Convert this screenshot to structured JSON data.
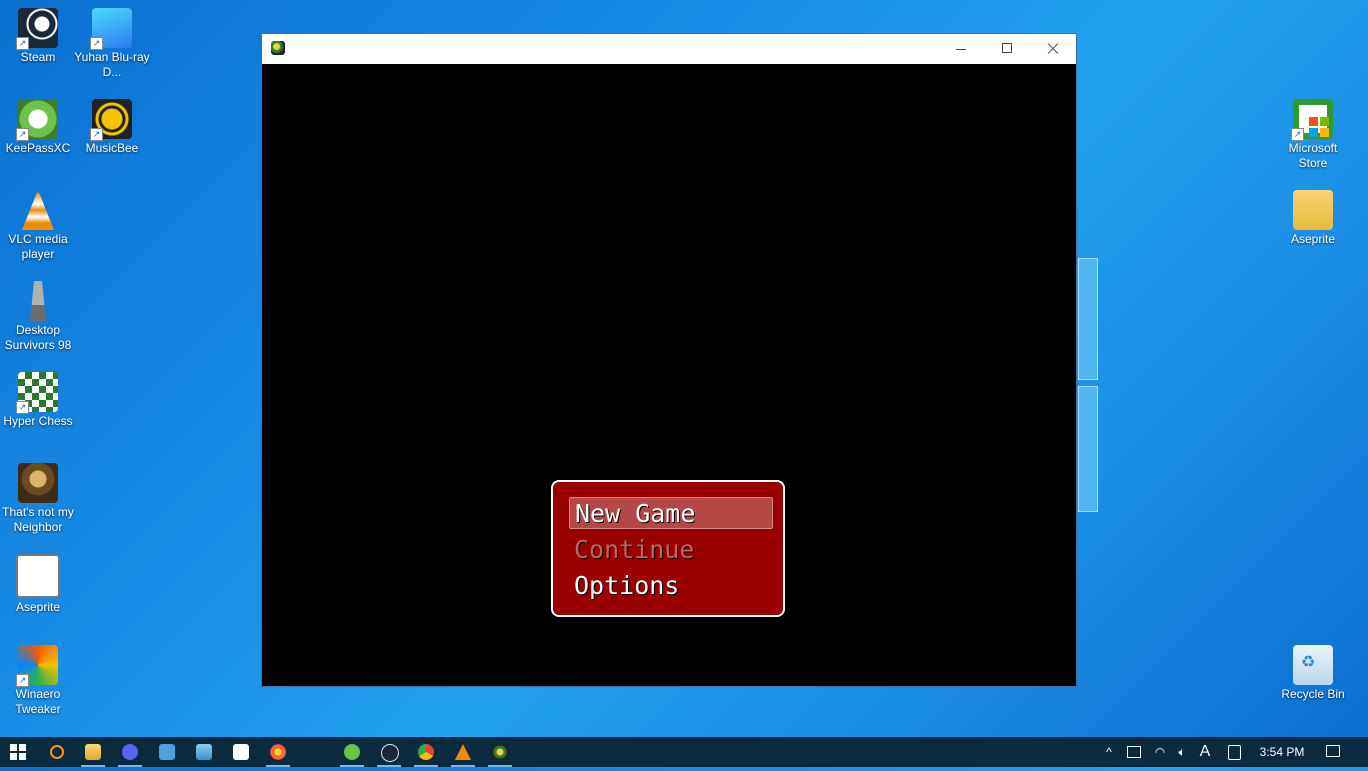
{
  "desktop": {
    "icons_left": [
      {
        "label": "Steam",
        "icon": "steam-icon"
      },
      {
        "label": "Yuhan Blu-ray D...",
        "icon": "yuhan-bluray-icon"
      },
      {
        "label": "KeePassXC",
        "icon": "keepassxc-icon"
      },
      {
        "label": "MusicBee",
        "icon": "musicbee-icon"
      },
      {
        "label": "VLC media player",
        "icon": "vlc-icon"
      },
      {
        "label": "Desktop Survivors 98",
        "icon": "desktop-survivors-icon"
      },
      {
        "label": "Hyper Chess",
        "icon": "hyper-chess-icon"
      },
      {
        "label": "That's not my Neighbor",
        "icon": "thats-not-my-neighbor-icon"
      },
      {
        "label": "Aseprite",
        "icon": "aseprite-icon"
      },
      {
        "label": "Winaero Tweaker",
        "icon": "winaero-tweaker-icon"
      }
    ],
    "icons_right": [
      {
        "label": "Microsoft Store",
        "icon": "microsoft-store-icon"
      },
      {
        "label": "Aseprite",
        "icon": "folder-icon"
      },
      {
        "label": "Recycle Bin",
        "icon": "recycle-bin-icon"
      }
    ]
  },
  "window": {
    "title": "",
    "controls": {
      "minimize": "minimize",
      "maximize": "maximize",
      "close": "close"
    }
  },
  "game": {
    "menu": {
      "items": [
        {
          "label": "New Game",
          "state": "selected"
        },
        {
          "label": "Continue",
          "state": "disabled"
        },
        {
          "label": "Options",
          "state": "normal"
        }
      ],
      "background": "#9a0000"
    }
  },
  "taskbar": {
    "items": [
      "windows-start-icon",
      "search-icon",
      "file-explorer-icon",
      "discord-icon",
      "control-panel-icon",
      "photos-icon",
      "microsoft-store-icon",
      "firefox-icon",
      "keepassxc-icon",
      "steam-icon",
      "chrome-icon",
      "vlc-icon",
      "game-app-icon"
    ],
    "tray": {
      "ime": "A",
      "time": "3:54 PM"
    }
  },
  "colors": {
    "accent": "#0078d7",
    "taskbar": "#0c2a3e"
  }
}
